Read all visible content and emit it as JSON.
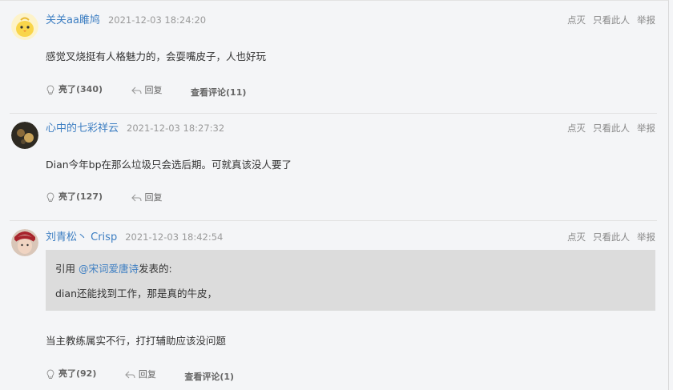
{
  "ops": {
    "dislike": "点灭",
    "only_this": "只看此人",
    "report": "举报"
  },
  "actions": {
    "like": "亮了",
    "reply": "回复",
    "view_comments": "查看评论"
  },
  "posts": [
    {
      "username": "关关aa雎鸠",
      "time": "2021-12-03 18:24:20",
      "content": "感觉叉烧挺有人格魅力的，会耍嘴皮子，人也好玩",
      "likes": "(340)",
      "comments": "(11)"
    },
    {
      "username": "心中的七彩祥云",
      "time": "2021-12-03 18:27:32",
      "content": "Dian今年bp在那么垃圾只会选后期。可就真该没人要了",
      "likes": "(127)"
    },
    {
      "username": "刘青松丶 Crisp",
      "time": "2021-12-03 18:42:54",
      "quote": {
        "prefix": "引用 ",
        "mention": "@宋词爱唐诗",
        "suffix": "发表的:",
        "text": "dian还能找到工作，那是真的牛皮，"
      },
      "content": "当主教练属实不行，打打辅助应该没问题",
      "likes": "(92)",
      "comments": "(1)"
    }
  ]
}
